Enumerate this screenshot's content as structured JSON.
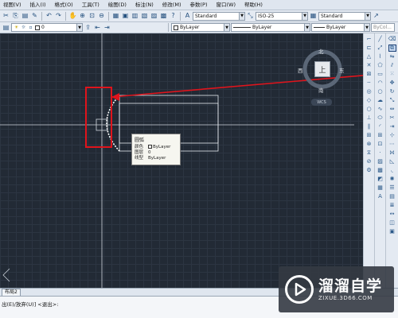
{
  "menu": {
    "items": [
      "视图(V)",
      "插入(I)",
      "格式(O)",
      "工具(T)",
      "绘图(D)",
      "标注(N)",
      "修改(M)",
      "参数(P)",
      "窗口(W)",
      "帮助(H)"
    ]
  },
  "styles_toolbar": {
    "text_style": "Standard",
    "dim_style": "ISO-25",
    "table_style": "Standard"
  },
  "layers_toolbar": {
    "layer_value": "0",
    "color": "ByLayer",
    "linetype": "ByLayer",
    "lineweight": "ByLayer",
    "plot_style": "ByCol..."
  },
  "viewcube": {
    "north": "北",
    "south": "南",
    "west": "西",
    "east": "东",
    "top_face": "上",
    "wcs": "WCS"
  },
  "tooltip": {
    "title": "圆弧",
    "rows": [
      {
        "key": "颜色",
        "value": "ByLayer",
        "has_swatch": true
      },
      {
        "key": "图层",
        "value": "0",
        "has_swatch": false
      },
      {
        "key": "线型",
        "value": "ByLayer",
        "has_swatch": false
      }
    ]
  },
  "tabs": {
    "layout": "布局2"
  },
  "command_line": {
    "prompt": "出(E)/放弃(U)] <退出>:"
  },
  "watermark": {
    "title": "溜溜自学",
    "url": "ZIXUE.3D66.COM"
  },
  "colors": {
    "highlight": "#e0141c",
    "canvas": "#222a35",
    "crosshair": "#d0d6dd"
  }
}
